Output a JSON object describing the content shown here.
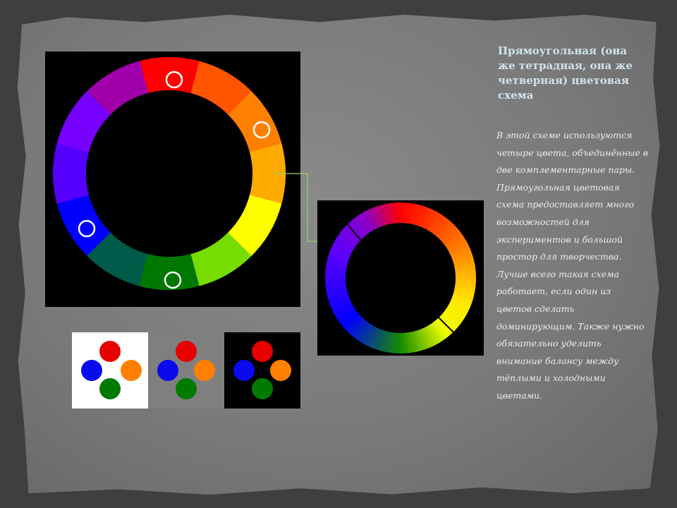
{
  "slide": {
    "title": "Прямоугольная (она же тетрадная, она же четверная) цветовая схема",
    "body": "В этой схеме используются четыре цвета, объединённые в две комплементарные пары. Прямоугольная цветовая схема предоставляет много возможностей для экспериментов и большой простор для творчества. Лучше всего такая схема работает, если один из цветов сделать доминирующим. Также нужно обязательно уделить внимание балансу между тёплыми и холодными цветами."
  },
  "color_wheel": {
    "segments": [
      "#ff0000",
      "#ff5500",
      "#ff7f00",
      "#ffaa00",
      "#ffff00",
      "#77dd00",
      "#007700",
      "#005a4a",
      "#0000ff",
      "#5500ff",
      "#7700ff",
      "#a000aa"
    ],
    "selected": [
      "red",
      "orange",
      "green",
      "blue"
    ]
  },
  "swatch_colors": {
    "red": "#e60000",
    "orange": "#ff7f00",
    "green": "#007b00",
    "blue": "#0a0aef"
  },
  "swatch_backgrounds": [
    "white",
    "gray",
    "black"
  ],
  "colors": {
    "connector": "#8fd26a",
    "title": "#cfe3ef",
    "text": "#e8eef2"
  }
}
